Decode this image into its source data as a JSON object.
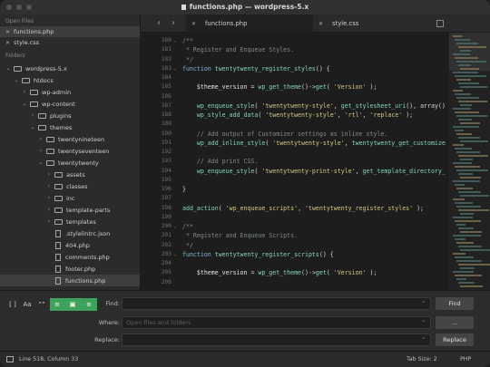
{
  "window": {
    "title": "functions.php — wordpress-5.x"
  },
  "sidebar": {
    "open_files_label": "Open Files",
    "open_files": [
      "functions.php",
      "style.css"
    ],
    "folders_label": "Folders",
    "tree": [
      {
        "label": "wordpress-5.x",
        "type": "folder",
        "expanded": true
      },
      {
        "label": "htdocs",
        "type": "folder",
        "expanded": true
      },
      {
        "label": "wp-admin",
        "type": "folder",
        "expanded": false
      },
      {
        "label": "wp-content",
        "type": "folder",
        "expanded": true
      },
      {
        "label": "plugins",
        "type": "folder",
        "expanded": false
      },
      {
        "label": "themes",
        "type": "folder",
        "expanded": true
      },
      {
        "label": "twentynineteen",
        "type": "folder",
        "expanded": false
      },
      {
        "label": "twentyseventeen",
        "type": "folder",
        "expanded": false
      },
      {
        "label": "twentytwenty",
        "type": "folder",
        "expanded": true
      },
      {
        "label": "assets",
        "type": "folder",
        "expanded": false
      },
      {
        "label": "classes",
        "type": "folder",
        "expanded": false
      },
      {
        "label": "inc",
        "type": "folder",
        "expanded": false
      },
      {
        "label": "template-parts",
        "type": "folder",
        "expanded": false
      },
      {
        "label": "templates",
        "type": "folder",
        "expanded": false
      },
      {
        "label": ".stylelintrc.json",
        "type": "file"
      },
      {
        "label": "404.php",
        "type": "file"
      },
      {
        "label": "comments.php",
        "type": "file"
      },
      {
        "label": "footer.php",
        "type": "file"
      },
      {
        "label": "functions.php",
        "type": "file",
        "selected": true
      }
    ]
  },
  "tabs": [
    {
      "label": "functions.php",
      "active": true
    },
    {
      "label": "style.css",
      "active": false
    }
  ],
  "editor": {
    "lines": [
      {
        "n": "180",
        "fold": true,
        "tokens": [
          [
            "c-com",
            "/**"
          ]
        ]
      },
      {
        "n": "181",
        "tokens": [
          [
            "c-com",
            " * Register and Enqueue Styles."
          ]
        ]
      },
      {
        "n": "182",
        "tokens": [
          [
            "c-com",
            " */"
          ]
        ]
      },
      {
        "n": "183",
        "fold": true,
        "tokens": [
          [
            "c-kw",
            "function "
          ],
          [
            "c-fn",
            "twentytwenty_register_styles"
          ],
          [
            "c-pl",
            "() {"
          ]
        ]
      },
      {
        "n": "184",
        "tokens": []
      },
      {
        "n": "185",
        "tokens": [
          [
            "c-var",
            "    $theme_version "
          ],
          [
            "c-pl",
            "= "
          ],
          [
            "c-fn",
            "wp_get_theme"
          ],
          [
            "c-pl",
            "()->"
          ],
          [
            "c-fn",
            "get"
          ],
          [
            "c-pl",
            "( "
          ],
          [
            "c-str",
            "'Version'"
          ],
          [
            "c-pl",
            " );"
          ]
        ]
      },
      {
        "n": "186",
        "tokens": []
      },
      {
        "n": "187",
        "tokens": [
          [
            "c-fn",
            "    wp_enqueue_style"
          ],
          [
            "c-pl",
            "( "
          ],
          [
            "c-str",
            "'twentytwenty-style'"
          ],
          [
            "c-pl",
            ", "
          ],
          [
            "c-fn",
            "get_stylesheet_uri"
          ],
          [
            "c-pl",
            "(), array()"
          ]
        ]
      },
      {
        "n": "188",
        "tokens": [
          [
            "c-fn",
            "    wp_style_add_data"
          ],
          [
            "c-pl",
            "( "
          ],
          [
            "c-str",
            "'twentytwenty-style'"
          ],
          [
            "c-pl",
            ", "
          ],
          [
            "c-str",
            "'rtl'"
          ],
          [
            "c-pl",
            ", "
          ],
          [
            "c-str",
            "'replace'"
          ],
          [
            "c-pl",
            " );"
          ]
        ]
      },
      {
        "n": "189",
        "tokens": []
      },
      {
        "n": "190",
        "tokens": [
          [
            "c-com",
            "    // Add output of Customizer settings as inline style."
          ]
        ]
      },
      {
        "n": "191",
        "tokens": [
          [
            "c-fn",
            "    wp_add_inline_style"
          ],
          [
            "c-pl",
            "( "
          ],
          [
            "c-str",
            "'twentytwenty-style'"
          ],
          [
            "c-pl",
            ", "
          ],
          [
            "c-fn",
            "twentytwenty_get_customize"
          ]
        ]
      },
      {
        "n": "192",
        "tokens": []
      },
      {
        "n": "193",
        "tokens": [
          [
            "c-com",
            "    // Add print CSS."
          ]
        ]
      },
      {
        "n": "194",
        "tokens": [
          [
            "c-fn",
            "    wp_enqueue_style"
          ],
          [
            "c-pl",
            "( "
          ],
          [
            "c-str",
            "'twentytwenty-print-style'"
          ],
          [
            "c-pl",
            ", "
          ],
          [
            "c-fn",
            "get_template_directory_"
          ]
        ]
      },
      {
        "n": "195",
        "tokens": []
      },
      {
        "n": "196",
        "tokens": [
          [
            "c-pl",
            "}"
          ]
        ]
      },
      {
        "n": "197",
        "tokens": []
      },
      {
        "n": "198",
        "tokens": [
          [
            "c-fn",
            "add_action"
          ],
          [
            "c-pl",
            "( "
          ],
          [
            "c-str",
            "'wp_enqueue_scripts'"
          ],
          [
            "c-pl",
            ", "
          ],
          [
            "c-str",
            "'twentytwenty_register_styles'"
          ],
          [
            "c-pl",
            " );"
          ]
        ]
      },
      {
        "n": "199",
        "tokens": []
      },
      {
        "n": "200",
        "fold": true,
        "tokens": [
          [
            "c-com",
            "/**"
          ]
        ]
      },
      {
        "n": "201",
        "tokens": [
          [
            "c-com",
            " * Register and Enqueue Scripts."
          ]
        ]
      },
      {
        "n": "202",
        "tokens": [
          [
            "c-com",
            " */"
          ]
        ]
      },
      {
        "n": "203",
        "fold": true,
        "tokens": [
          [
            "c-kw",
            "function "
          ],
          [
            "c-fn",
            "twentytwenty_register_scripts"
          ],
          [
            "c-pl",
            "() {"
          ]
        ]
      },
      {
        "n": "204",
        "tokens": []
      },
      {
        "n": "205",
        "tokens": [
          [
            "c-var",
            "    $theme_version "
          ],
          [
            "c-pl",
            "= "
          ],
          [
            "c-fn",
            "wp_get_theme"
          ],
          [
            "c-pl",
            "()->"
          ],
          [
            "c-fn",
            "get"
          ],
          [
            "c-pl",
            "( "
          ],
          [
            "c-str",
            "'Version'"
          ],
          [
            "c-pl",
            " );"
          ]
        ]
      },
      {
        "n": "206",
        "tokens": []
      }
    ]
  },
  "find": {
    "options": [
      "[ ]",
      "Aa",
      "“”",
      "≡",
      "▣",
      "≡"
    ],
    "find_label": "Find:",
    "where_label": "Where:",
    "where_placeholder": "Open files and folders",
    "replace_label": "Replace:",
    "find_button": "Find",
    "where_button": "...",
    "replace_button": "Replace"
  },
  "status": {
    "position": "Line 518, Column 33",
    "tab_size": "Tab Size: 2",
    "syntax": "PHP"
  },
  "colors": {
    "accent_green": "#3da25a",
    "string": "#d4c982",
    "function": "#84d7b7",
    "keyword": "#7bb6d6",
    "comment": "#7f8a8a"
  }
}
